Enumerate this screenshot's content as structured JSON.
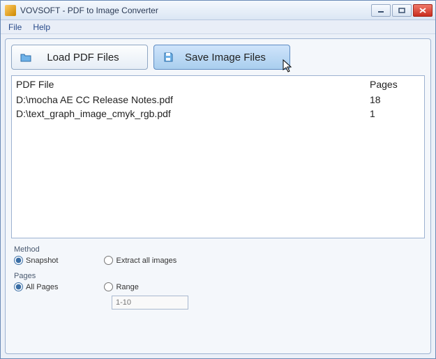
{
  "title": "VOVSOFT - PDF to Image Converter",
  "menu": {
    "file": "File",
    "help": "Help"
  },
  "toolbar": {
    "load_label": "Load PDF Files",
    "save_label": "Save Image Files"
  },
  "list": {
    "col_file": "PDF File",
    "col_pages": "Pages",
    "rows": [
      {
        "file": "D:\\mocha AE CC Release Notes.pdf",
        "pages": "18"
      },
      {
        "file": "D:\\text_graph_image_cmyk_rgb.pdf",
        "pages": "1"
      }
    ]
  },
  "method": {
    "label": "Method",
    "snapshot": "Snapshot",
    "extract": "Extract all images",
    "selected": "snapshot"
  },
  "pages": {
    "label": "Pages",
    "all": "All Pages",
    "range": "Range",
    "selected": "all",
    "range_placeholder": "1-10"
  }
}
